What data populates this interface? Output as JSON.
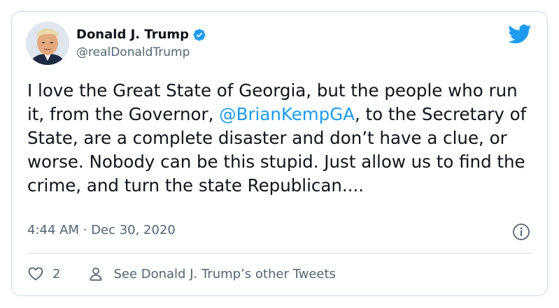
{
  "author": {
    "display_name": "Donald J. Trump",
    "handle": "@realDonaldTrump",
    "verified": true,
    "avatar_icon": "avatar-photo"
  },
  "tweet": {
    "text_before_mention": "I love the Great State of Georgia, but the people who run it, from the Governor, ",
    "mention": "@BrianKempGA",
    "text_after_mention": ", to the Secretary of State, are a complete disaster and don’t have a clue, or worse. Nobody can be this stupid. Just allow us to find the crime, and turn the state Republican...."
  },
  "meta": {
    "timestamp": "4:44 AM · Dec 30, 2020"
  },
  "actions": {
    "like_count": "2",
    "other_tweets_label": "See Donald J. Trump’s other Tweets"
  },
  "icons": {
    "brand": "twitter-bird-icon",
    "verified": "verified-badge-icon",
    "info": "info-icon",
    "like": "heart-icon",
    "profile": "person-icon"
  },
  "colors": {
    "accent": "#1d9bf0",
    "text": "#0f1419",
    "secondary": "#536471",
    "border": "#cfd9de"
  }
}
